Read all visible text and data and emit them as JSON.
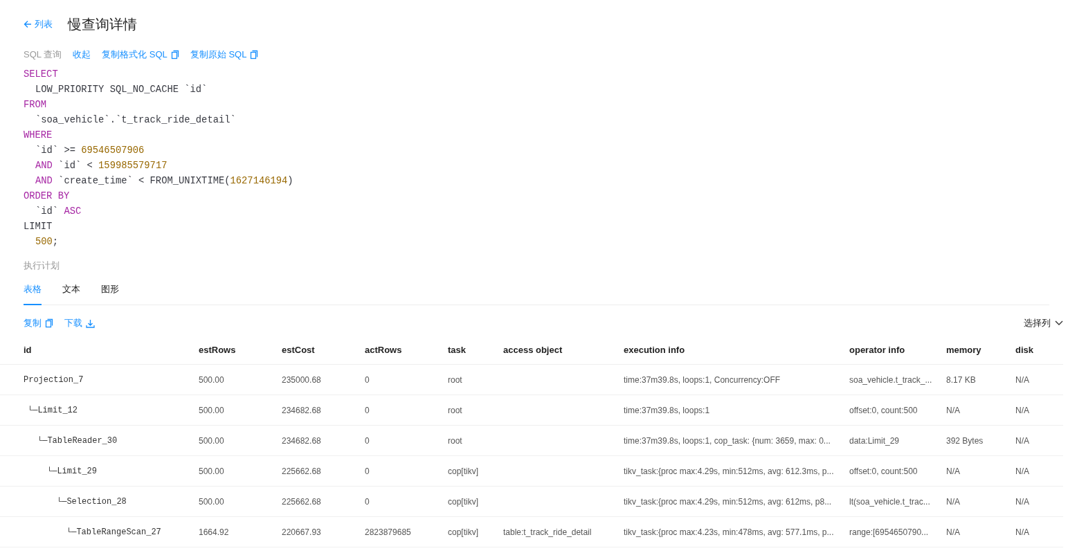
{
  "header": {
    "back_link": "列表",
    "title": "慢查询详情"
  },
  "sql_section": {
    "label": "SQL 查询",
    "actions": [
      {
        "label": "收起",
        "kind": "link"
      },
      {
        "label": "复制格式化 SQL",
        "kind": "copy"
      },
      {
        "label": "复制原始 SQL",
        "kind": "copy"
      }
    ],
    "code": [
      {
        "indent": false,
        "tokens": [
          {
            "kind": "keyword",
            "text": "SELECT"
          }
        ]
      },
      {
        "indent": true,
        "tokens": [
          {
            "kind": "plain",
            "text": "LOW_PRIORITY SQL_NO_CACHE `id`"
          }
        ]
      },
      {
        "indent": false,
        "tokens": [
          {
            "kind": "keyword",
            "text": "FROM"
          }
        ]
      },
      {
        "indent": true,
        "tokens": [
          {
            "kind": "plain",
            "text": "`soa_vehicle`.`t_track_ride_detail`"
          }
        ]
      },
      {
        "indent": false,
        "tokens": [
          {
            "kind": "keyword",
            "text": "WHERE"
          }
        ]
      },
      {
        "indent": true,
        "tokens": [
          {
            "kind": "plain",
            "text": "`id` >= "
          },
          {
            "kind": "number",
            "text": "69546507906"
          }
        ]
      },
      {
        "indent": true,
        "tokens": [
          {
            "kind": "keyword",
            "text": "AND"
          },
          {
            "kind": "plain",
            "text": " `id` < "
          },
          {
            "kind": "number",
            "text": "159985579717"
          }
        ]
      },
      {
        "indent": true,
        "tokens": [
          {
            "kind": "keyword",
            "text": "AND"
          },
          {
            "kind": "plain",
            "text": " `create_time` < FROM_UNIXTIME("
          },
          {
            "kind": "number",
            "text": "1627146194"
          },
          {
            "kind": "plain",
            "text": ")"
          }
        ]
      },
      {
        "indent": false,
        "tokens": [
          {
            "kind": "keyword",
            "text": "ORDER BY"
          }
        ]
      },
      {
        "indent": true,
        "tokens": [
          {
            "kind": "plain",
            "text": "`id` "
          },
          {
            "kind": "keyword",
            "text": "ASC"
          }
        ]
      },
      {
        "indent": false,
        "tokens": [
          {
            "kind": "plain",
            "text": "LIMIT"
          }
        ]
      },
      {
        "indent": true,
        "tokens": [
          {
            "kind": "number",
            "text": "500"
          },
          {
            "kind": "plain",
            "text": ";"
          }
        ]
      }
    ]
  },
  "plan_section": {
    "label": "执行计划",
    "tabs": [
      {
        "label": "表格",
        "selected": true
      },
      {
        "label": "文本",
        "selected": false
      },
      {
        "label": "图形",
        "selected": false
      }
    ],
    "actions": [
      {
        "label": "复制",
        "kind": "copy"
      },
      {
        "label": "下载",
        "kind": "download"
      }
    ],
    "column_picker": "选择列",
    "table": {
      "columns": [
        "id",
        "estRows",
        "estCost",
        "actRows",
        "task",
        "access object",
        "execution info",
        "operator info",
        "memory",
        "disk"
      ],
      "rows": [
        {
          "prefix": "",
          "cells": [
            "Projection_7",
            "500.00",
            "235000.68",
            "0",
            "root",
            "",
            "time:37m39.8s, loops:1, Concurrency:OFF",
            "soa_vehicle.t_track_...",
            "8.17 KB",
            "N/A"
          ],
          "children": [
            {
              "prefix": "└─",
              "cells": [
                "Limit_12",
                "500.00",
                "234682.68",
                "0",
                "root",
                "",
                "time:37m39.8s, loops:1",
                "offset:0, count:500",
                "N/A",
                "N/A"
              ],
              "children": [
                {
                  "prefix": "└─",
                  "cells": [
                    "TableReader_30",
                    "500.00",
                    "234682.68",
                    "0",
                    "root",
                    "",
                    "time:37m39.8s, loops:1, cop_task: {num: 3659, max: 0...",
                    "data:Limit_29",
                    "392 Bytes",
                    "N/A"
                  ],
                  "children": [
                    {
                      "prefix": "└─",
                      "cells": [
                        "Limit_29",
                        "500.00",
                        "225662.68",
                        "0",
                        "cop[tikv]",
                        "",
                        "tikv_task:{proc max:4.29s, min:512ms, avg: 612.3ms, p...",
                        "offset:0, count:500",
                        "N/A",
                        "N/A"
                      ],
                      "children": [
                        {
                          "prefix": "└─",
                          "cells": [
                            "Selection_28",
                            "500.00",
                            "225662.68",
                            "0",
                            "cop[tikv]",
                            "",
                            "tikv_task:{proc max:4.29s, min:512ms, avg: 612ms, p8...",
                            "lt(soa_vehicle.t_trac...",
                            "N/A",
                            "N/A"
                          ],
                          "children": [
                            {
                              "prefix": "└─",
                              "cells": [
                                "TableRangeScan_27",
                                "1664.92",
                                "220667.93",
                                "2823879685",
                                "cop[tikv]",
                                "table:t_track_ride_detail",
                                "tikv_task:{proc max:4.23s, min:478ms, avg: 577.1ms, p...",
                                "range:[6954650790...",
                                "N/A",
                                "N/A"
                              ]
                            }
                          ]
                        }
                      ]
                    }
                  ]
                }
              ]
            }
          ]
        }
      ]
    }
  }
}
